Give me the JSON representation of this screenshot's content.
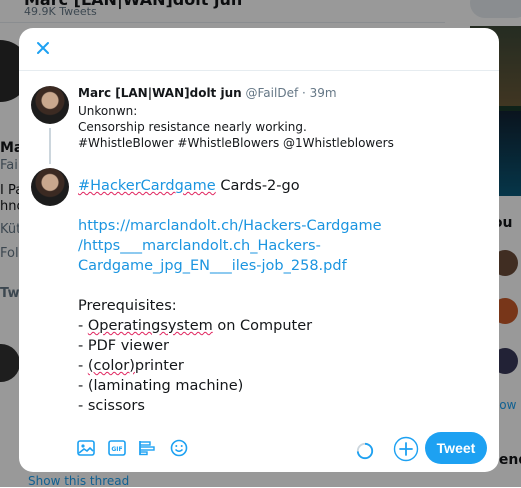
{
  "background": {
    "header_title": "Marc [LAN|WAN]dolt jun",
    "tweets_count": "49.9K Tweets",
    "side_fragments": [
      "Marc",
      "FailDe",
      "I Pa",
      "hno",
      "Küt",
      "Fol",
      "Twe"
    ],
    "right_section_title": "You m",
    "right_show_more": "Show m",
    "right_trend_label": "Trend",
    "show_this_thread": "Show this thread"
  },
  "modal": {
    "close_icon": "close-icon",
    "quoted_tweet": {
      "name": "Marc [LAN|WAN]dolt jun",
      "handle": "@FailDef",
      "separator": "·",
      "time": "39m",
      "lines": [
        "Unkonwn:",
        "Censorship resistance nearly working.",
        "#WhistleBlower #WhistleBlowers @1Whistleblowers"
      ]
    },
    "compose": {
      "hashtag": "#HackerCardgame",
      "first_line_rest": " Cards-2-go",
      "link_lines": [
        "https://marclandolt.ch/Hackers-Cardgame",
        "/https___marclandolt.ch_Hackers-",
        "Cardgame_jpg_EN___iles-job_258.pdf"
      ],
      "prereq_title": "Prerequisites:",
      "items": [
        "- Operatingsystem on Computer",
        "- PDF viewer",
        "- (color)printer",
        "- (laminating machine)",
        "- scissors"
      ]
    },
    "toolbar": {
      "icons": [
        "image-icon",
        "gif-icon",
        "poll-icon",
        "emoji-icon"
      ],
      "tweet_label": "Tweet",
      "accent_color": "#1da1f2"
    }
  }
}
